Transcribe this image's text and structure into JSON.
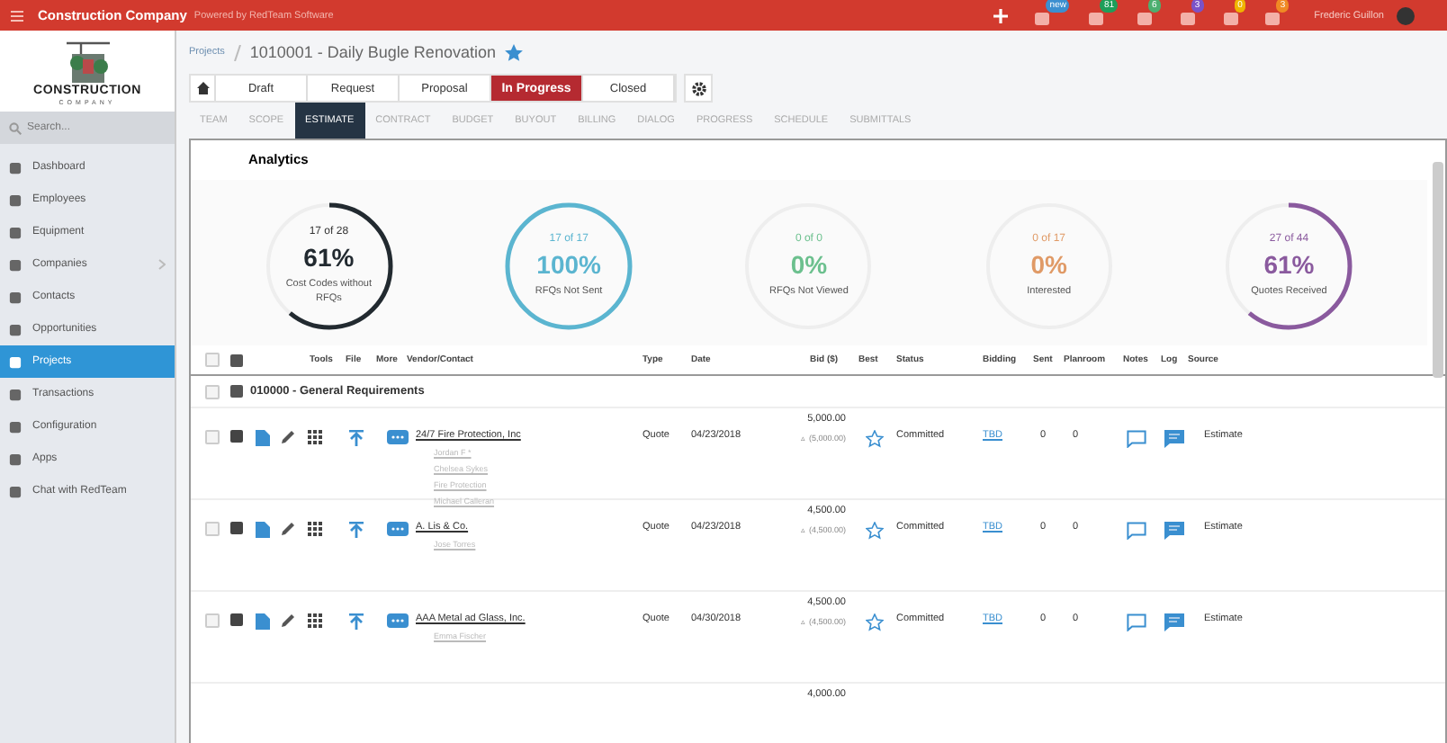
{
  "topbar": {
    "title": "Construction Company",
    "subtitle": "Powered by RedTeam Software",
    "user": "Frederic Guillon",
    "badges": [
      {
        "text": "new",
        "color": "#3b8fd0"
      },
      {
        "text": "81",
        "color": "#1e9e5a"
      },
      {
        "text": "6",
        "color": "#4caf70"
      },
      {
        "text": "3",
        "color": "#7b52c7"
      },
      {
        "text": "0",
        "color": "#f0b400"
      },
      {
        "text": "3",
        "color": "#f08a24"
      }
    ]
  },
  "logo": {
    "name": "CONSTRUCTION",
    "tagline": "COMPANY"
  },
  "search": {
    "placeholder": "Search..."
  },
  "sidebar": {
    "items": [
      {
        "label": "Dashboard",
        "selected": false
      },
      {
        "label": "Employees",
        "selected": false
      },
      {
        "label": "Equipment",
        "selected": false
      },
      {
        "label": "Companies",
        "selected": false,
        "expandable": true
      },
      {
        "label": "Contacts",
        "selected": false
      },
      {
        "label": "Opportunities",
        "selected": false
      },
      {
        "label": "Projects",
        "selected": true
      },
      {
        "label": "Transactions",
        "selected": false
      },
      {
        "label": "Configuration",
        "selected": false
      },
      {
        "label": "Apps",
        "selected": false
      },
      {
        "label": "Chat with RedTeam",
        "selected": false
      }
    ]
  },
  "breadcrumb": {
    "parent": "Projects",
    "title": "1010001 - Daily Bugle Renovation",
    "starred": true
  },
  "pipeline": [
    {
      "label": "Draft",
      "selected": false
    },
    {
      "label": "Request",
      "selected": false
    },
    {
      "label": "Proposal",
      "selected": false
    },
    {
      "label": "In Progress",
      "selected": true
    },
    {
      "label": "Closed",
      "selected": false
    }
  ],
  "tabs": [
    {
      "label": "TEAM",
      "selected": false
    },
    {
      "label": "SCOPE",
      "selected": false
    },
    {
      "label": "ESTIMATE",
      "selected": true
    },
    {
      "label": "CONTRACT",
      "selected": false
    },
    {
      "label": "BUDGET",
      "selected": false
    },
    {
      "label": "BUYOUT",
      "selected": false
    },
    {
      "label": "BILLING",
      "selected": false
    },
    {
      "label": "DIALOG",
      "selected": false
    },
    {
      "label": "PROGRESS",
      "selected": false
    },
    {
      "label": "SCHEDULE",
      "selected": false
    },
    {
      "label": "SUBMITTALS",
      "selected": false
    }
  ],
  "analytics": {
    "title": "Analytics",
    "gauges": [
      {
        "count": "17 of 28",
        "percent": "61%",
        "label": "Cost Codes without RFQs",
        "level": 0.61,
        "color": "#222a30"
      },
      {
        "count": "17 of 17",
        "percent": "100%",
        "label": "RFQs Not Sent",
        "level": 1,
        "color": "#5bb5d0"
      },
      {
        "count": "0 of 0",
        "percent": "0%",
        "label": "RFQs Not Viewed",
        "level": 0,
        "color": "#6cc08e"
      },
      {
        "count": "0 of 17",
        "percent": "0%",
        "label": "Interested",
        "level": 0,
        "color": "#e09a66"
      },
      {
        "count": "27 of 44",
        "percent": "61%",
        "label": "Quotes Received",
        "level": 0.61,
        "color": "#8a5a9e"
      }
    ]
  },
  "table": {
    "header_checked": false,
    "group_checked": false,
    "columns": [
      "Tools",
      "File",
      "More",
      "Vendor/Contact",
      "Type",
      "Date",
      "Bid ($)",
      "Best",
      "Status",
      "Bidding",
      "Sent",
      "Planroom",
      "Notes",
      "Log",
      "Source"
    ],
    "group": "010000 - General Requirements",
    "rows": [
      {
        "checked": false,
        "vendor": "24/7 Fire Protection, Inc",
        "contacts": [
          "Jordan F *",
          "Chelsea Sykes",
          "Fire Protection",
          "Michael Calleran"
        ],
        "type": "Quote",
        "date": "04/23/2018",
        "bid": "5,000.00",
        "bid_sub": "▵ (5,000.00)",
        "status": "Committed",
        "bidding": "TBD",
        "sent": "0",
        "planroom": "0",
        "source": "Estimate",
        "best": false
      },
      {
        "checked": false,
        "vendor": "A. Lis & Co.",
        "contacts": [
          "Jose Torres"
        ],
        "type": "Quote",
        "date": "04/23/2018",
        "bid": "4,500.00",
        "bid_sub": "▵ (4,500.00)",
        "status": "Committed",
        "bidding": "TBD",
        "sent": "0",
        "planroom": "0",
        "source": "Estimate",
        "best": false
      },
      {
        "checked": false,
        "vendor": "AAA Metal ad Glass, Inc.",
        "contacts": [
          "Emma Fischer"
        ],
        "type": "Quote",
        "date": "04/30/2018",
        "bid": "4,500.00",
        "bid_sub": "▵ (4,500.00)",
        "status": "Committed",
        "bidding": "TBD",
        "sent": "0",
        "planroom": "0",
        "source": "Estimate",
        "best": false
      },
      {
        "bid": "4,000.00"
      }
    ]
  }
}
